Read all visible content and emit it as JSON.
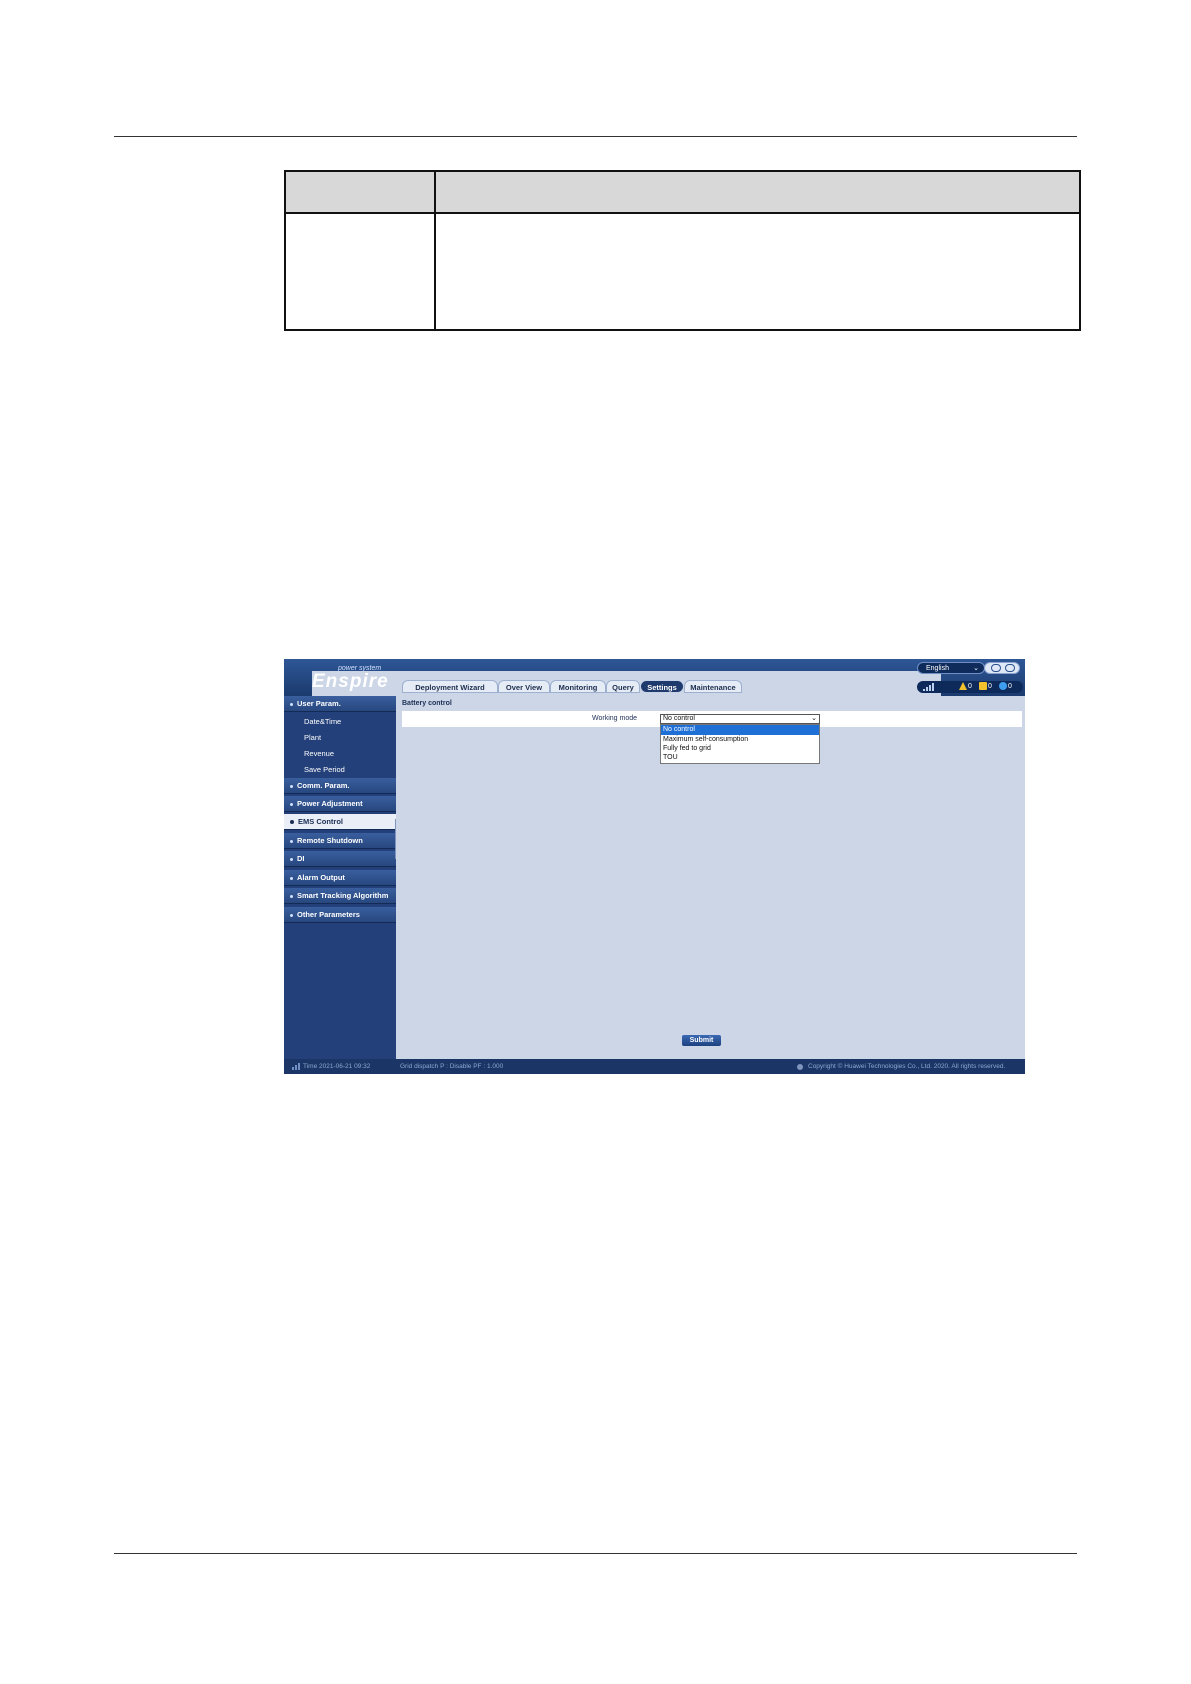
{
  "app": {
    "logo_sub": "power system",
    "logo_main": "Enspire",
    "language": "English",
    "tabs": [
      "Deployment Wizard",
      "Over View",
      "Monitoring",
      "Query",
      "Settings",
      "Maintenance"
    ],
    "active_tab": "Settings",
    "alarms": {
      "major": "0",
      "minor": "0",
      "warning": "0"
    }
  },
  "sidebar": {
    "user_param": "User Param.",
    "sub_items": [
      "Date&Time",
      "Plant",
      "Revenue",
      "Save Period"
    ],
    "items": [
      "Comm. Param.",
      "Power Adjustment",
      "EMS Control",
      "Remote Shutdown",
      "DI",
      "Alarm Output",
      "Smart Tracking Algorithm",
      "Other Parameters"
    ],
    "active_item": "EMS Control"
  },
  "main": {
    "panel_title": "Battery control",
    "field_label": "Working mode",
    "selected_value": "No control",
    "options": [
      "No control",
      "Maximum self-consumption",
      "Fully fed to grid",
      "TOU"
    ],
    "submit_label": "Submit"
  },
  "footer": {
    "time": "Time  2021-06-21 09:32",
    "dispatch": "Grid dispatch   P : Disable   PF : 1.000",
    "copyright": "Copyright © Huawei Technologies Co., Ltd. 2020. All rights reserved."
  },
  "colors": {
    "header": "#23407a",
    "content": "#ccd6e7",
    "selected_option": "#1e6fd6"
  }
}
